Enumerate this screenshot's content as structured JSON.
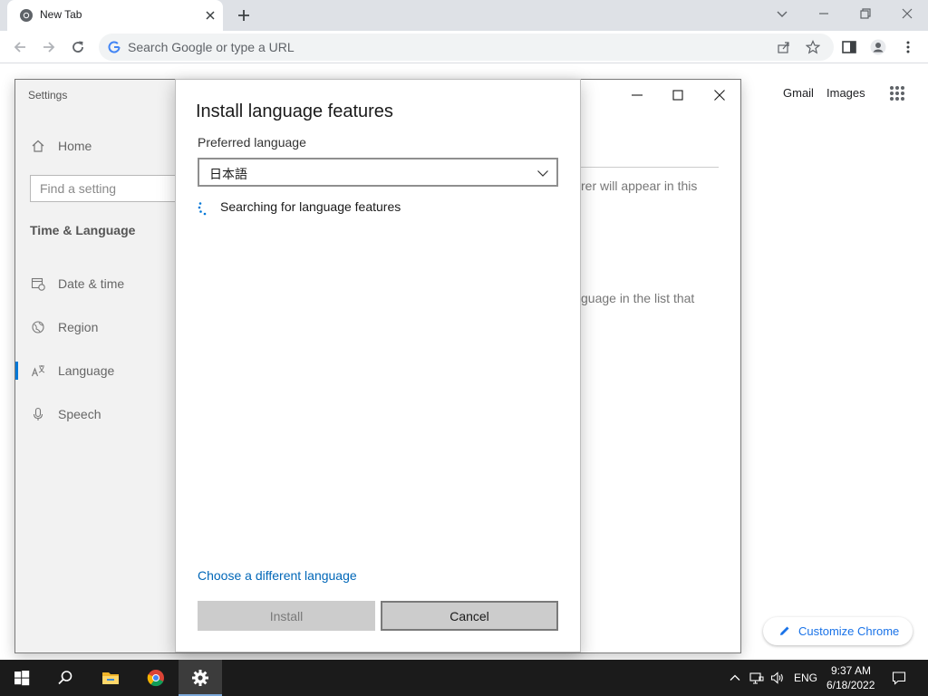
{
  "browser": {
    "tab_title": "New Tab",
    "omnibox_placeholder": "Search Google or type a URL",
    "links": {
      "gmail": "Gmail",
      "images": "Images"
    },
    "customize_label": "Customize Chrome"
  },
  "settings": {
    "app_title": "Settings",
    "search_placeholder": "Find a setting",
    "section_title": "Time & Language",
    "nav": {
      "home": "Home",
      "date_time": "Date & time",
      "region": "Region",
      "language": "Language",
      "speech": "Speech"
    },
    "background_text": {
      "line1": "rer will appear in this",
      "line2": "guage in the list that"
    }
  },
  "dialog": {
    "title": "Install language features",
    "preferred_label": "Preferred language",
    "selected_language": "日本語",
    "status": "Searching for language features",
    "link": "Choose a different language",
    "install_label": "Install",
    "cancel_label": "Cancel"
  },
  "taskbar": {
    "language": "ENG",
    "time": "9:37 AM",
    "date": "6/18/2022"
  },
  "colors": {
    "accent": "#0078d7",
    "link": "#0067b8",
    "chrome_blue": "#1a73e8",
    "taskbar": "#1b1b1b"
  }
}
